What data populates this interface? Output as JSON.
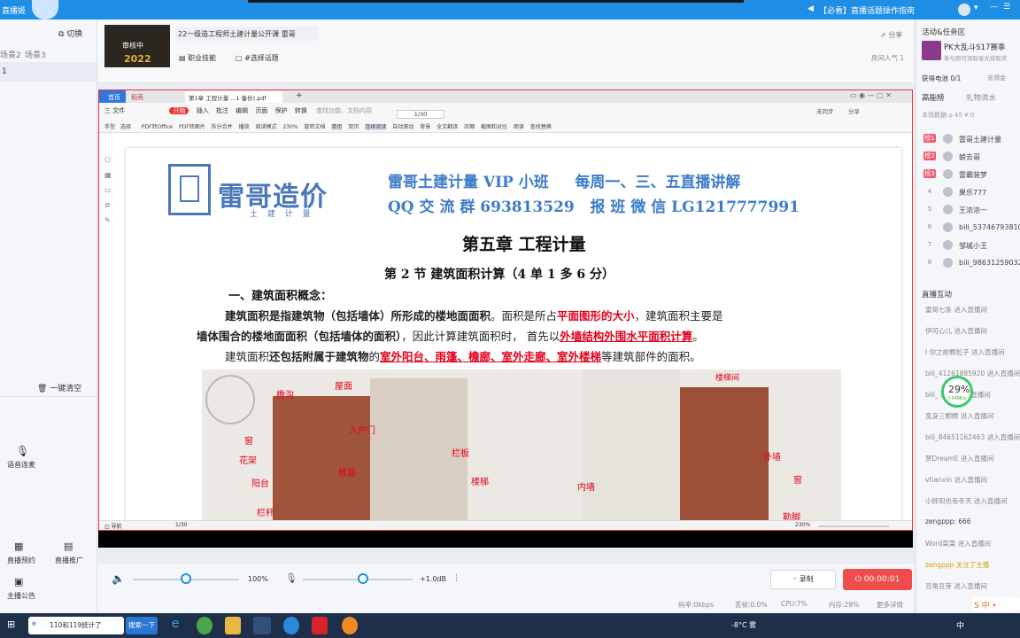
{
  "topbar": {
    "app_title": "直播姬",
    "notice": "【必看】直播话题操作指南",
    "icons": [
      "speaker-icon",
      "avatar-icon",
      "menu-icon",
      "minimize-icon",
      "maximize-icon"
    ]
  },
  "left": {
    "switch_label": "切换",
    "scenes": [
      "场景2",
      "场景3"
    ],
    "scene_index": "1",
    "clear_label": "一键清空",
    "voice_label": "语音连麦",
    "bottom_buttons": [
      "直播预约",
      "直播推广",
      "主播公告"
    ]
  },
  "stream": {
    "thumb_badge": "审核中",
    "thumb_year": "2022",
    "title": "22一级造工程师土建计量公开课 雷哥",
    "tag1": "职业技能",
    "tag2": "#选择话题",
    "share": "分享",
    "popularity": "房间人气 1"
  },
  "pdf": {
    "tabs": [
      "首页",
      "稻壳",
      "第1章 工程计量 ...1 备份).pdf"
    ],
    "menus": [
      "三 文件",
      "开始",
      "插入",
      "批注",
      "编辑",
      "页面",
      "保护",
      "转换"
    ],
    "search_placeholder": "查找功能、文档内容",
    "right_menus": [
      "未同步",
      "分享"
    ],
    "tools": [
      "手型",
      "选择",
      "PDF转Office",
      "PDF转图片",
      "拆分合并",
      "播放",
      "阅读模式",
      "230%",
      "旋转文档",
      "单页",
      "双页",
      "连续阅读",
      "自动滚动",
      "背景",
      "全文翻译",
      "压缩",
      "截图和对比",
      "朗读",
      "查找替换"
    ],
    "page": "1/30",
    "zoom": "230%"
  },
  "doc": {
    "logo_name": "雷哥造价",
    "logo_sub": "土 建 计 量",
    "header_line1": "雷哥土建计量 VIP 小班     每周一、三、五直播讲解",
    "header_line2": "QQ 交 流 群 693813529   报 班 微 信 LG1217777991",
    "chapter": "第五章 工程计量",
    "section": "第 2 节 建筑面积计算（4 单 1 多 6 分）",
    "heading": "一、建筑面积概念：",
    "p1a": "建筑面积是指建筑物（包括墙体）所形成的楼地面面积",
    "p1b": "。面积是所占",
    "p1c": "平面图形的大小",
    "p1d": "，建筑面积主要是",
    "p2a": "墙体围合的楼地面面积（包括墙体的面积）",
    "p2b": "，因此计算建筑面积时，  首先以",
    "p2c": "外墙结构外围水平面积计算",
    "p2d": "。",
    "p3a": "建筑面积",
    "p3b": "还包括附属于建筑物",
    "p3c": "的",
    "p3d": "室外阳台、雨篷、檐廊、室外走廊、室外楼梯",
    "p3e": "等建筑部件的面积。",
    "img_labels": [
      "檐沟",
      "屋面",
      "窗",
      "花架",
      "阳台",
      "栏杆",
      "入户门",
      "栏板",
      "楼面",
      "楼梯",
      "楼梯间",
      "外墙",
      "窗",
      "内墙",
      "勒脚"
    ]
  },
  "controls": {
    "volume": "100%",
    "gain": "+1.0dB",
    "record": "录制",
    "timer": "00:00:01"
  },
  "status": {
    "bitrate": "码率:0kbps",
    "frame_loss": "丢帧:0.0%",
    "cpu": "CPU:7%",
    "memory": "内存:29%",
    "more": "更多详情"
  },
  "right": {
    "activity_title": "活动&任务区",
    "pk_title": "PK大乱斗S17赛季",
    "pk_sub": "参与即可领取星光获取奖",
    "gift_progress": "获得电池  0/1",
    "gift_link": "去领金",
    "tab1": "高能榜",
    "tab2": "礼物流水",
    "stats": "本场数据  ⌂ 45  ¥ 0",
    "ranking": [
      {
        "rank": "榜1",
        "name": "雷哥土建计量"
      },
      {
        "rank": "榜2",
        "name": "娘去哥"
      },
      {
        "rank": "榜3",
        "name": "雷霸装梦"
      },
      {
        "rank": "4",
        "name": "果乐777"
      },
      {
        "rank": "5",
        "name": "王浓浓一"
      },
      {
        "rank": "6",
        "name": "bili_53746793810"
      },
      {
        "rank": "7",
        "name": "邹城小王"
      },
      {
        "rank": "8",
        "name": "bili_98631259032"
      }
    ],
    "interact_title": "直播互动",
    "events": [
      "雷哥七条 进入直播间",
      "伊可心儿 进入直播间",
      "I 你之前颗粒子 进入直播间",
      "bili_41261885920 进入直播间",
      "bili_ 2 50 进入直播间",
      "宽身三颗颗 进入直播间",
      "bili_84651162463 进入直播间",
      "梦DreamE 进入直播间",
      "vtianxin 进入直播间",
      "小胖阳也有冬天 进入直播间",
      "zengppp: 666",
      "Word菜菜 进入直播间",
      "zengppp 关注了主播",
      "豆角豆芽 进入直播间"
    ],
    "cpu_ring": "29%",
    "cpu_speed": "↑349K/s"
  },
  "taskbar": {
    "search_task": "110和119统计了",
    "search_button": "搜索一下",
    "weather": "-8°C 雾",
    "lang": "中"
  }
}
